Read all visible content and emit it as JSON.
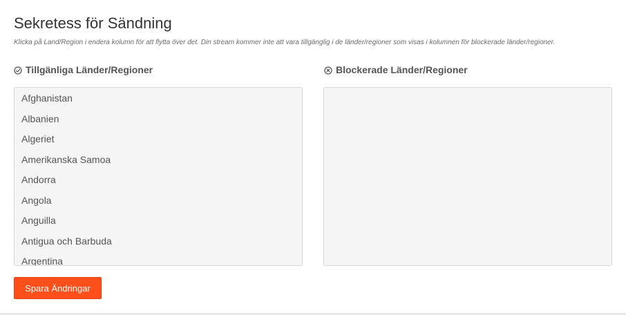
{
  "page": {
    "title": "Sekretess för Sändning",
    "subtitle": "Klicka på Land/Region i endera kolumn för att flytta över det. Din stream kommer inte att vara tillgänglig i de länder/regioner som visas i kolumnen för blockerade länder/regioner."
  },
  "available": {
    "header": "Tillgänliga Länder/Regioner",
    "icon": "check-circle-icon",
    "items": [
      "Afghanistan",
      "Albanien",
      "Algeriet",
      "Amerikanska Samoa",
      "Andorra",
      "Angola",
      "Anguilla",
      "Antigua och Barbuda",
      "Argentina"
    ]
  },
  "blocked": {
    "header": "Blockerade Länder/Regioner",
    "icon": "x-circle-icon",
    "items": []
  },
  "actions": {
    "save_label": "Spara Ändringar"
  },
  "colors": {
    "accent": "#fc4f1a",
    "list_bg": "#f5f5f5"
  }
}
